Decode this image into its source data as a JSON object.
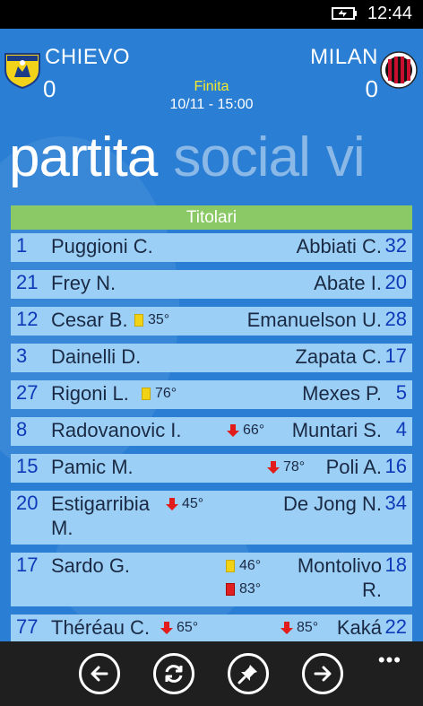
{
  "status_bar": {
    "time": "12:44",
    "battery_icon": "battery-charging-icon"
  },
  "match": {
    "home": {
      "name": "CHIEVO",
      "score": "0",
      "crest_icon": "chievo-crest-icon"
    },
    "away": {
      "name": "MILAN",
      "score": "0",
      "crest_icon": "milan-crest-icon"
    },
    "status": "Finita",
    "datetime": "10/11 - 15:00"
  },
  "pivot": {
    "tabs": [
      "partita",
      "social",
      "vi"
    ],
    "active_index": 0
  },
  "lineup": {
    "title": "Titolari",
    "rows": [
      {
        "home_num": "1",
        "home_name": "Puggioni C.",
        "away_name": "Abbiati C.",
        "away_num": "32"
      },
      {
        "home_num": "21",
        "home_name": "Frey N.",
        "away_name": "Abate I.",
        "away_num": "20"
      },
      {
        "home_num": "12",
        "home_name": "Cesar B.",
        "home_event": "35°",
        "away_name": "Emanuelson U.",
        "away_num": "28"
      },
      {
        "home_num": "3",
        "home_name": "Dainelli D.",
        "away_name": "Zapata C.",
        "away_num": "17"
      },
      {
        "home_num": "27",
        "home_name": "Rigoni L.",
        "home_event": "76°",
        "away_name": "Mexes P.",
        "away_num": "5"
      },
      {
        "home_num": "8",
        "home_name": "Radovanovic I.",
        "home_event": "66°",
        "away_name": "Muntari S.",
        "away_num": "4"
      },
      {
        "home_num": "15",
        "home_name": "Pamic M.",
        "home_event": "78°",
        "away_name": "Poli A.",
        "away_num": "16"
      },
      {
        "home_num": "20",
        "home_name_1": "Estigarribia",
        "home_name_2": "M.",
        "home_event": "45°",
        "away_name": "De Jong N.",
        "away_num": "34"
      },
      {
        "home_num": "17",
        "home_name": "Sardo G.",
        "away_event_1": "46°",
        "away_event_2": "83°",
        "away_name_1": "Montolivo",
        "away_name_2": "R.",
        "away_num": "18"
      },
      {
        "home_num": "77",
        "home_name": "Théréau C.",
        "home_event": "65°",
        "away_event": "85°",
        "away_name": "Kaká",
        "away_num": "22"
      }
    ]
  },
  "app_bar": {
    "buttons": [
      "back-arrow-icon",
      "refresh-icon",
      "pin-icon",
      "forward-arrow-icon"
    ],
    "more_label": "•••"
  }
}
